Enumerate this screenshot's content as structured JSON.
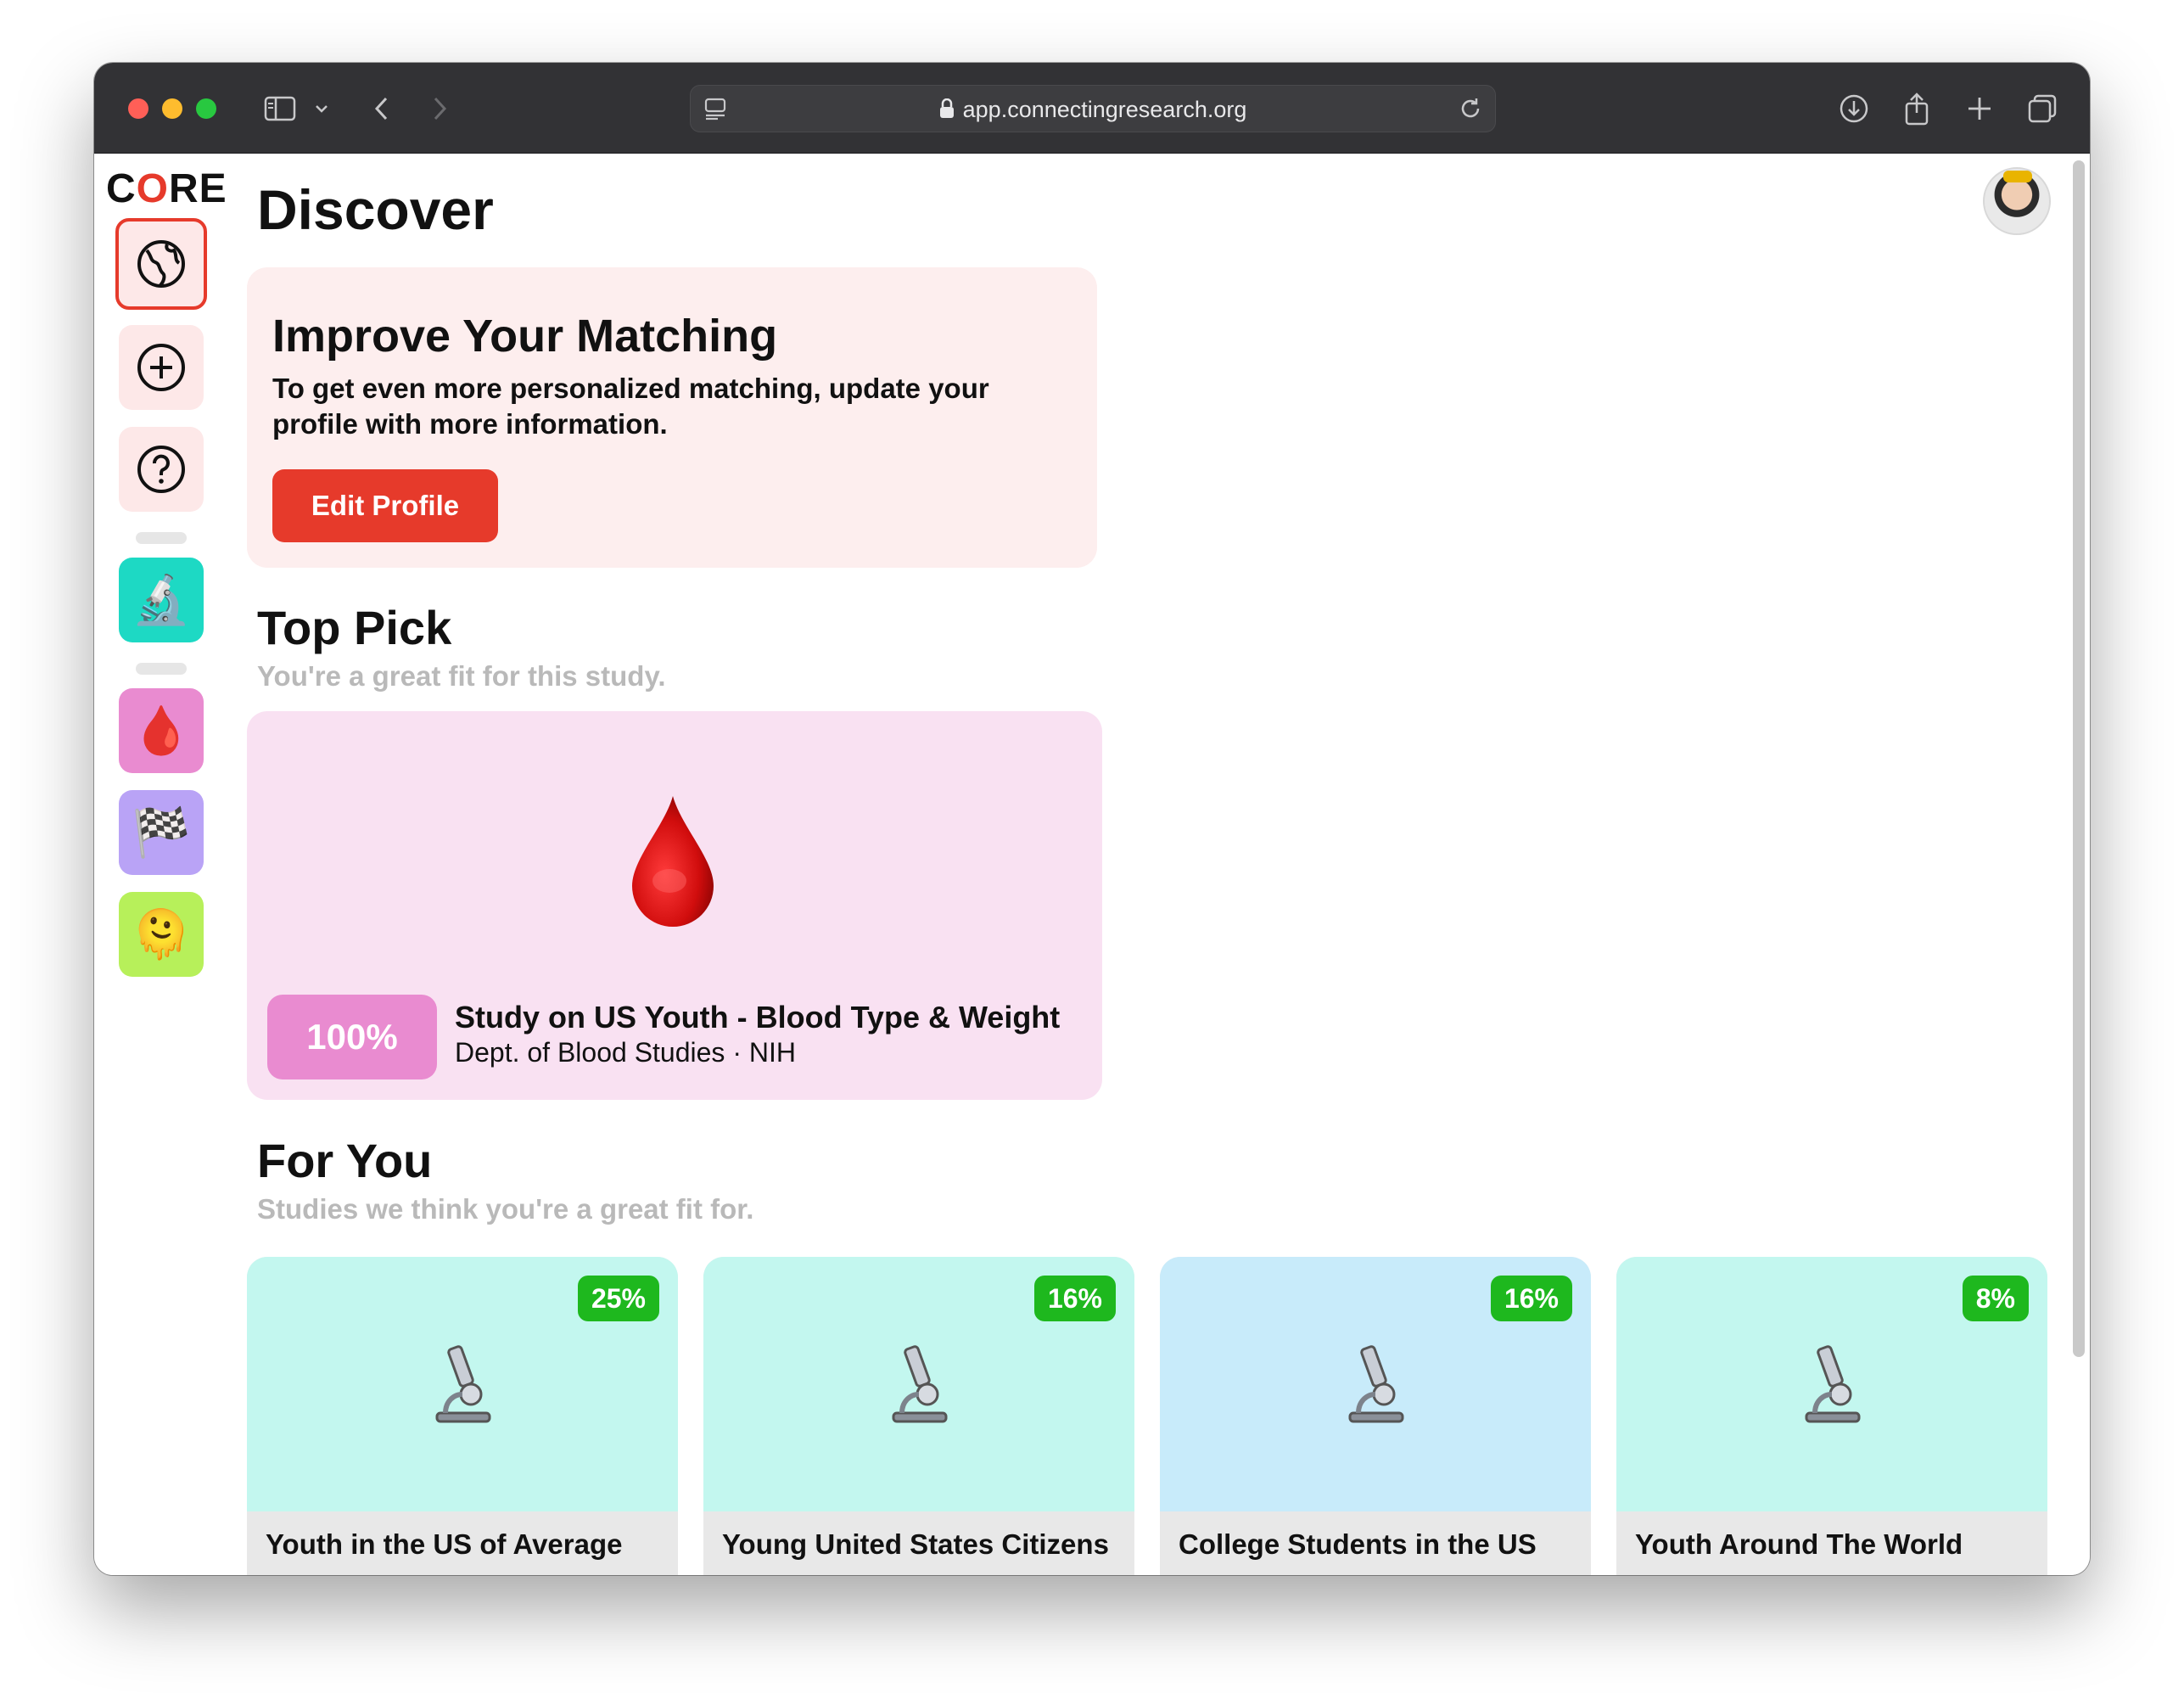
{
  "browser": {
    "url": "app.connectingresearch.org",
    "icons": [
      "sidebar-icon",
      "chevron-down-icon",
      "back-icon",
      "forward-icon",
      "tab-settings-icon",
      "lock-icon",
      "reload-icon",
      "download-icon",
      "share-icon",
      "new-tab-icon",
      "tab-overview-icon"
    ]
  },
  "sidebar": {
    "logo": {
      "prefix": "C",
      "accent": "O",
      "suffix": "RE"
    },
    "nav": [
      {
        "name": "discover",
        "icon": "globe-icon",
        "active": true
      },
      {
        "name": "create",
        "icon": "plus-circle-icon",
        "active": false
      },
      {
        "name": "help",
        "icon": "question-circle-icon",
        "active": false
      }
    ],
    "studies": [
      {
        "emoji": "🔬",
        "color": "#1dd9c4"
      },
      {
        "emoji": "🩸",
        "color": "#e98bd0"
      },
      {
        "emoji": "🏁",
        "color": "#b9a3f6"
      },
      {
        "emoji": "🫠",
        "color": "#b7f05a"
      }
    ]
  },
  "header": {
    "title": "Discover"
  },
  "improve": {
    "title": "Improve Your Matching",
    "text": "To get even more personalized matching, update your profile with more information.",
    "button": "Edit Profile"
  },
  "top_pick": {
    "title": "Top Pick",
    "subtitle": "You're a great fit for this study.",
    "emoji": "🩸",
    "match": "100%",
    "study_title": "Study on US Youth - Blood Type & Weight",
    "study_dept": "Dept. of Blood Studies · NIH"
  },
  "for_you": {
    "title": "For You",
    "subtitle": "Studies we think you're a great fit for.",
    "cards": [
      {
        "match": "25%",
        "title": "Youth in the US of Average",
        "emoji": "🔬",
        "color": "#c3f7ef"
      },
      {
        "match": "16%",
        "title": "Young United States Citizens",
        "emoji": "🔬",
        "color": "#c3f7ef"
      },
      {
        "match": "16%",
        "title": "College Students in the US",
        "emoji": "🔬",
        "color": "#c8ebfa"
      },
      {
        "match": "8%",
        "title": "Youth Around The World",
        "emoji": "🔬",
        "color": "#c3f7ef"
      }
    ]
  },
  "colors": {
    "accent": "#e63a2b",
    "badge_green": "#1eb81e",
    "pill_pink": "#e98bd0"
  }
}
